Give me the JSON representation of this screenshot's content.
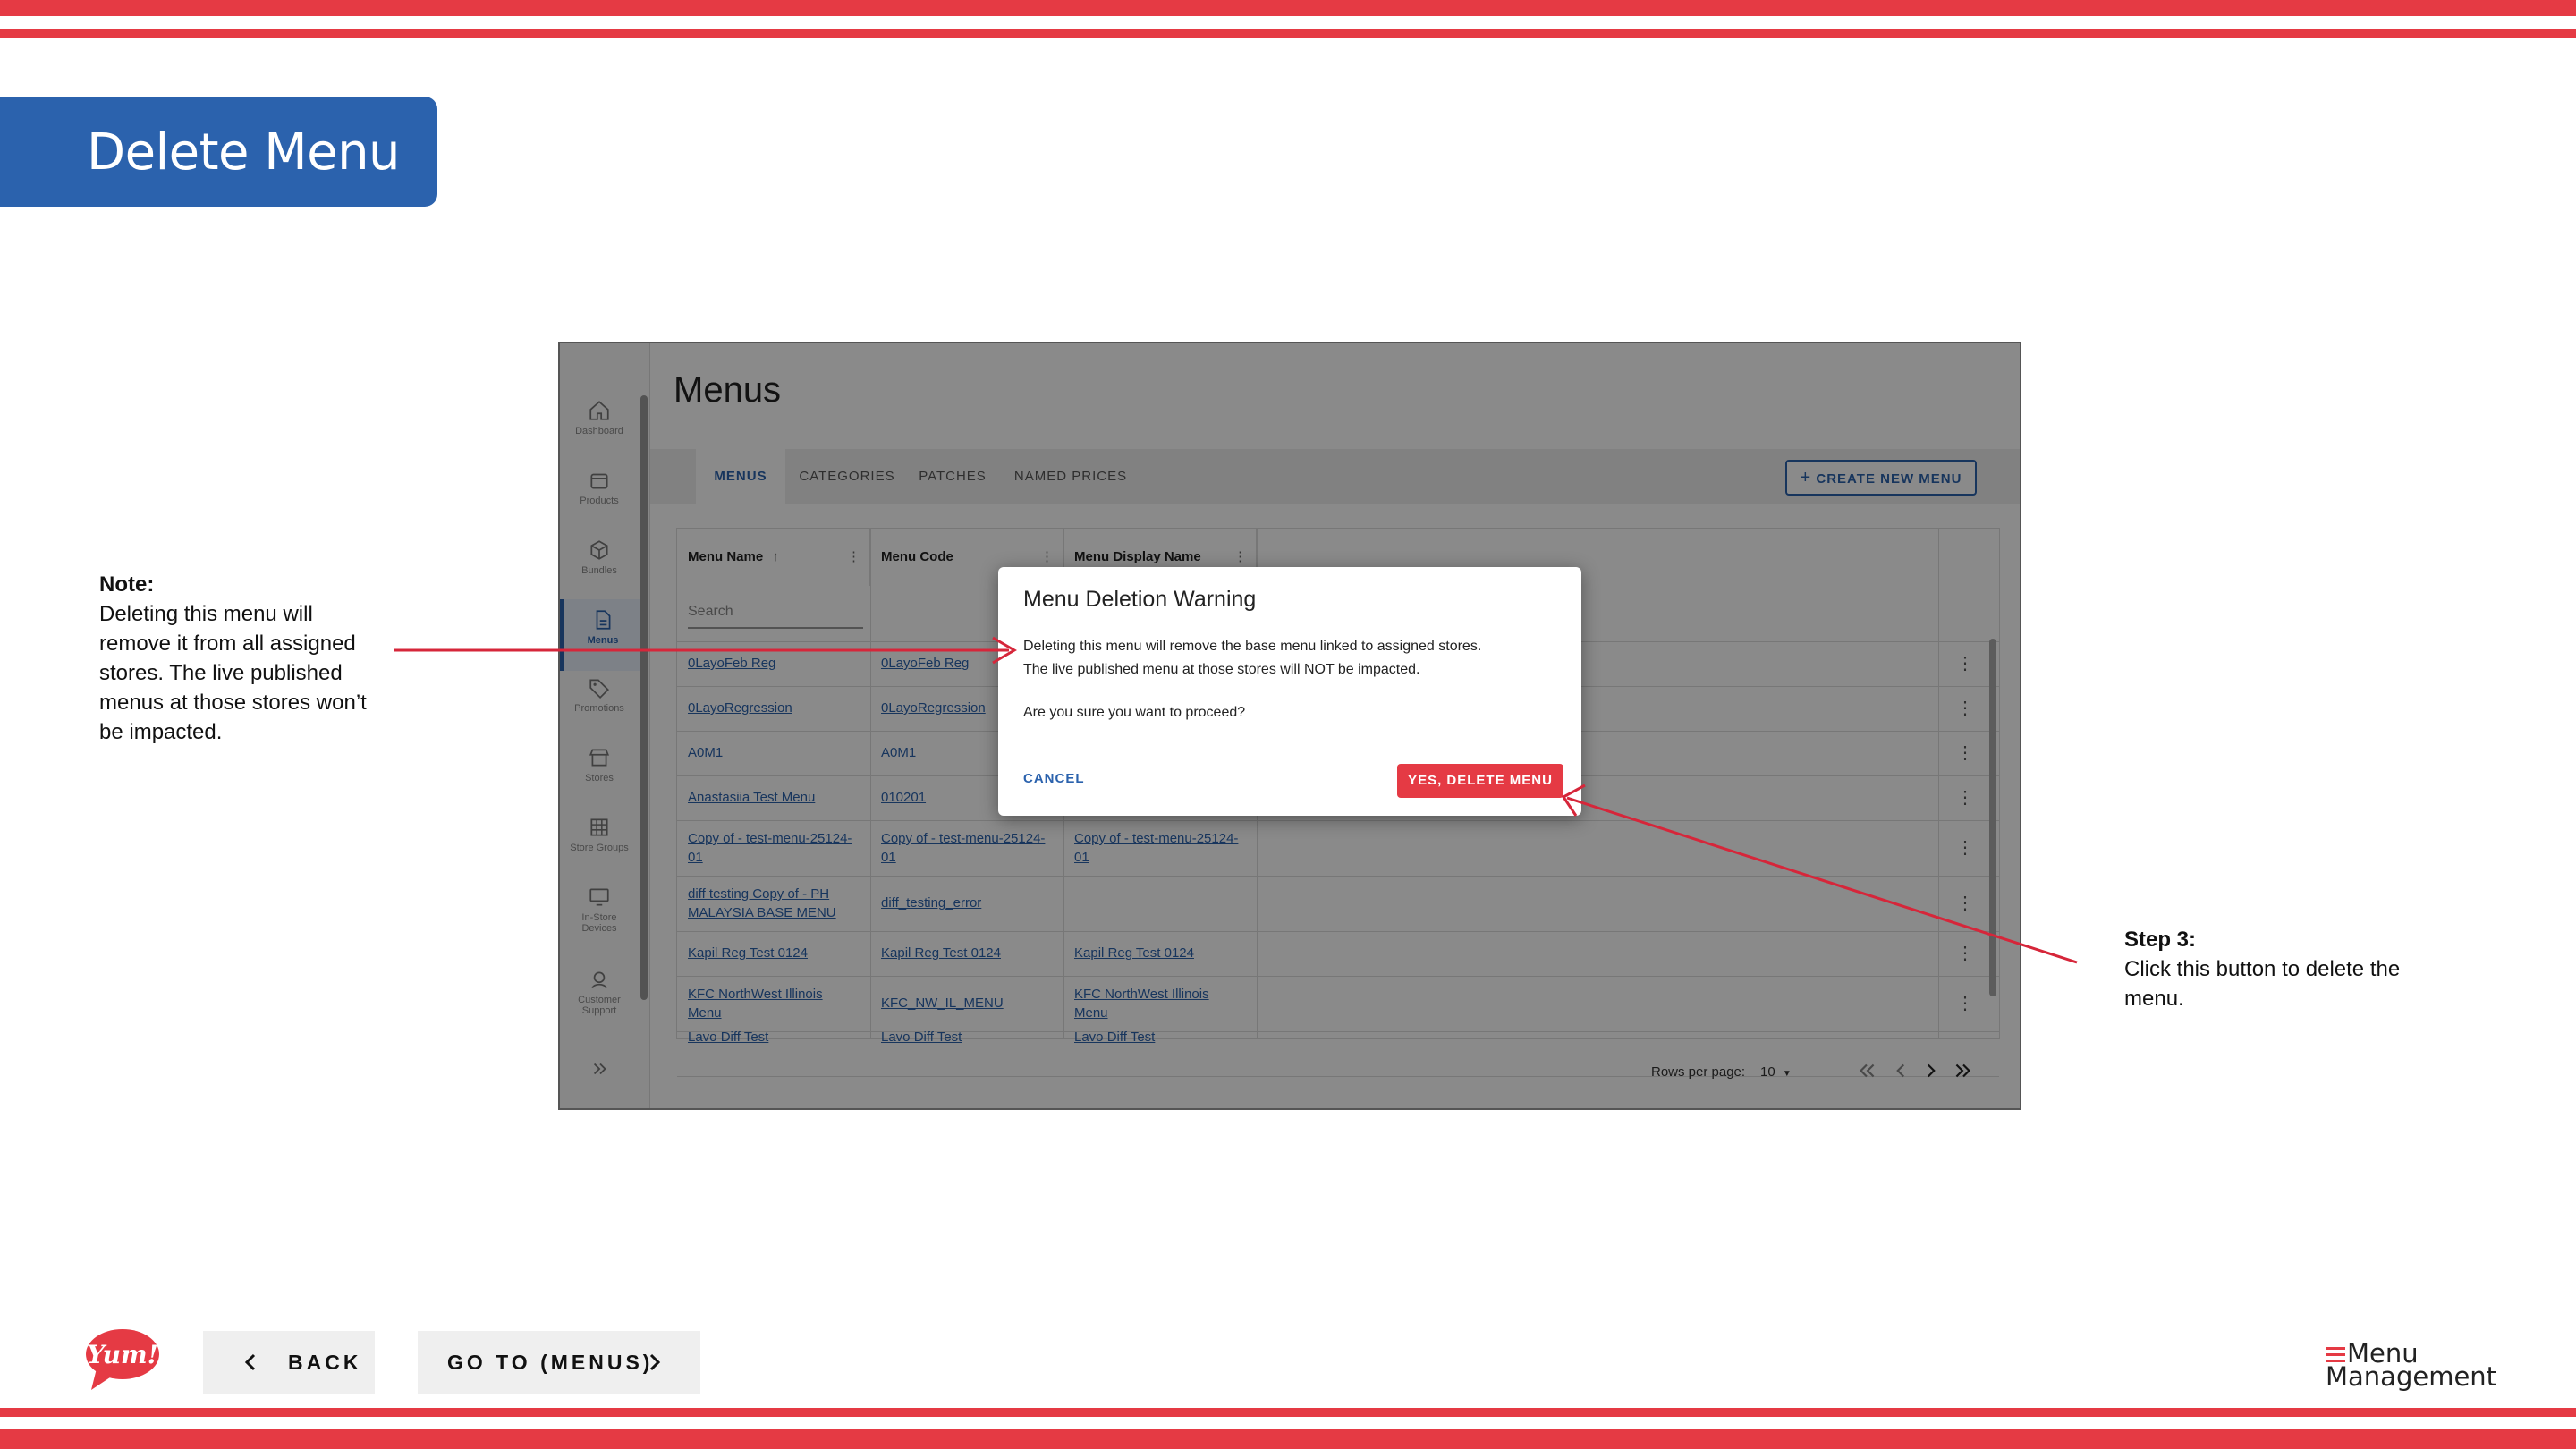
{
  "slide": {
    "title": "Delete Menu",
    "note": {
      "heading": "Note:",
      "lines": [
        "Deleting this menu will",
        "remove it from all assigned",
        "stores. The live published",
        "menus at those stores won’t",
        "be impacted."
      ]
    },
    "step": {
      "heading": "Step 3:",
      "lines": [
        "Click this button to delete the",
        "menu."
      ]
    }
  },
  "app": {
    "nav": [
      {
        "label": "Dashboard",
        "icon": "home-icon"
      },
      {
        "label": "Products",
        "icon": "box-icon"
      },
      {
        "label": "Bundles",
        "icon": "cube-icon"
      },
      {
        "label": "Menus",
        "icon": "document-icon",
        "active": true
      },
      {
        "label": "Promotions",
        "icon": "tag-icon"
      },
      {
        "label": "Stores",
        "icon": "store-icon"
      },
      {
        "label": "Store Groups",
        "icon": "grid-icon"
      },
      {
        "label": "In-Store Devices",
        "label_lines": [
          "In-Store",
          "Devices"
        ],
        "icon": "monitor-icon"
      },
      {
        "label": "Customer Support",
        "label_lines": [
          "Customer",
          "Support"
        ],
        "icon": "support-icon"
      }
    ],
    "page_title": "Menus",
    "tabs": [
      "MENUS",
      "CATEGORIES",
      "PATCHES",
      "NAMED PRICES"
    ],
    "create_button": "CREATE NEW MENU",
    "columns": [
      "Menu Name",
      "Menu Code",
      "Menu Display Name"
    ],
    "search_placeholder": "Search",
    "rows": [
      {
        "name": [
          "0LayoFeb Reg"
        ],
        "code": [
          "0LayoFeb Reg"
        ],
        "display": []
      },
      {
        "name": [
          "0LayoRegression"
        ],
        "code": [
          "0LayoRegression"
        ],
        "display": []
      },
      {
        "name": [
          "A0M1"
        ],
        "code": [
          "A0M1"
        ],
        "display": []
      },
      {
        "name": [
          "Anastasiia Test Menu"
        ],
        "code": [
          "010201"
        ],
        "display": []
      },
      {
        "name": [
          "Copy of - test-menu-25124-",
          "01"
        ],
        "code": [
          "Copy of - test-menu-25124-",
          "01"
        ],
        "display": [
          "Copy of - test-menu-25124-",
          "01"
        ]
      },
      {
        "name": [
          "diff testing Copy of - PH",
          "MALAYSIA BASE MENU"
        ],
        "code": [
          "diff_testing_error"
        ],
        "display": []
      },
      {
        "name": [
          "Kapil Reg Test 0124"
        ],
        "code": [
          "Kapil Reg Test 0124"
        ],
        "display": [
          "Kapil Reg Test 0124"
        ]
      },
      {
        "name": [
          "KFC NorthWest Illinois",
          "Menu"
        ],
        "code": [
          "KFC_NW_IL_MENU"
        ],
        "display": [
          "KFC NorthWest Illinois",
          "Menu"
        ]
      },
      {
        "name": [
          "Lavo Diff Test"
        ],
        "code": [
          "Lavo Diff Test"
        ],
        "display": [
          "Lavo Diff Test"
        ]
      }
    ],
    "pager": {
      "label": "Rows per page:",
      "value": "10"
    },
    "dialog": {
      "title": "Menu Deletion Warning",
      "line1": "Deleting this menu will remove the base menu linked to assigned stores.",
      "line2": "The live published menu at those stores will NOT be impacted.",
      "question": "Are you sure you want to proceed?",
      "cancel": "CANCEL",
      "confirm": "YES, DELETE MENU"
    }
  },
  "footer": {
    "logo_text": "Yum!",
    "back": "BACK",
    "go": "GO TO (MENUS)",
    "brand_line1": "Menu",
    "brand_line2": "Management"
  },
  "colors": {
    "accent_red": "#e53a44",
    "brand_blue": "#2b62ad"
  }
}
